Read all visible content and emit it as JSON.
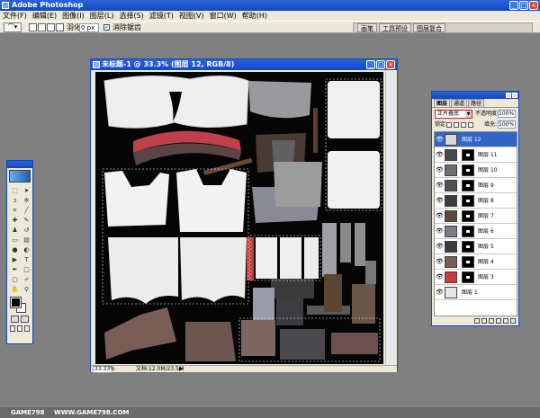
{
  "app": {
    "title": "Adobe Photoshop"
  },
  "menu": [
    "文件(F)",
    "编辑(E)",
    "图像(I)",
    "图层(L)",
    "选择(S)",
    "滤镜(T)",
    "视图(V)",
    "窗口(W)",
    "帮助(H)"
  ],
  "options": {
    "feather_label": "羽化:",
    "feather_value": "0 px",
    "antialias_label": "消除锯齿",
    "antialias_checked": true,
    "palette_tabs": [
      "画笔",
      "工具预设",
      "图层复合"
    ]
  },
  "document": {
    "title": "未标题-1 @ 33.3% (图层 12, RGB/8)",
    "zoom": "33.33%",
    "doc_info": "文档:12.0M/23.5M"
  },
  "layers_panel": {
    "tabs": [
      "图层",
      "通道",
      "路径"
    ],
    "active_tab": "图层",
    "blend_mode": "正片叠底",
    "opacity_label": "不透明度:",
    "opacity": "100%",
    "lock_label": "锁定:",
    "fill_label": "填充:",
    "fill": "100%",
    "layers": [
      {
        "name": "图层 12",
        "thumb": "#d8d8d8",
        "mask": false,
        "selected": true
      },
      {
        "name": "图层 11",
        "thumb": "#4a4a4a",
        "mask": true,
        "selected": false
      },
      {
        "name": "图层 10",
        "thumb": "#6e6e78",
        "mask": true,
        "selected": false
      },
      {
        "name": "图层 9",
        "thumb": "#505058",
        "mask": true,
        "selected": false
      },
      {
        "name": "图层 8",
        "thumb": "#3c3c3c",
        "mask": true,
        "selected": false
      },
      {
        "name": "图层 7",
        "thumb": "#5a4a3a",
        "mask": true,
        "selected": false
      },
      {
        "name": "图层 6",
        "thumb": "#7c7c84",
        "mask": true,
        "selected": false
      },
      {
        "name": "图层 5",
        "thumb": "#3a3a40",
        "mask": true,
        "selected": false
      },
      {
        "name": "图层 4",
        "thumb": "#7a5e56",
        "mask": true,
        "selected": false
      },
      {
        "name": "图层 3",
        "thumb": "#c83c3c",
        "mask": true,
        "selected": false
      },
      {
        "name": "图层 1",
        "thumb": "#e8e8e8",
        "mask": false,
        "selected": false
      }
    ]
  },
  "watermark": {
    "logo": "GAME798",
    "url": "WWW.GAME798.COM"
  }
}
